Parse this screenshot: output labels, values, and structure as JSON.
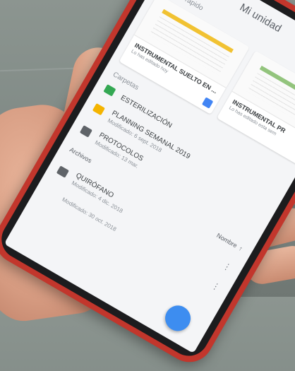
{
  "app": {
    "title": "Mi unidad"
  },
  "quick_access": {
    "label": "Acceso rápido",
    "cards": [
      {
        "title": "INSTRUMENTAL SUELTO EN ...",
        "subtitle": "Lo has editado hoy"
      },
      {
        "title": "INSTRUMENTAL PR",
        "subtitle": "Lo has editado esta sem"
      }
    ]
  },
  "folders": {
    "label": "Carpetas",
    "items": [
      {
        "name": "ESTERILIZACIÓN",
        "meta": "",
        "color": "#34a853"
      },
      {
        "name": "PLANNING SEMANAL 2019",
        "meta": "Modificado: 6 sept. 2018",
        "color": "#f4b400"
      },
      {
        "name": "PROTOCOLOS",
        "meta": "Modificado: 13 mar.",
        "color": "#5f6368"
      }
    ]
  },
  "files_sort": {
    "label": "Nombre",
    "arrow": "↑"
  },
  "files": {
    "label": "Archivos",
    "items": [
      {
        "name": "QUIRÓFANO",
        "meta": "Modificado: 4 dic. 2018",
        "color": "#5f6368"
      },
      {
        "name": "",
        "meta": "Modificado: 30 oct. 2018",
        "color": ""
      }
    ]
  },
  "menu_glyph": "⋮"
}
